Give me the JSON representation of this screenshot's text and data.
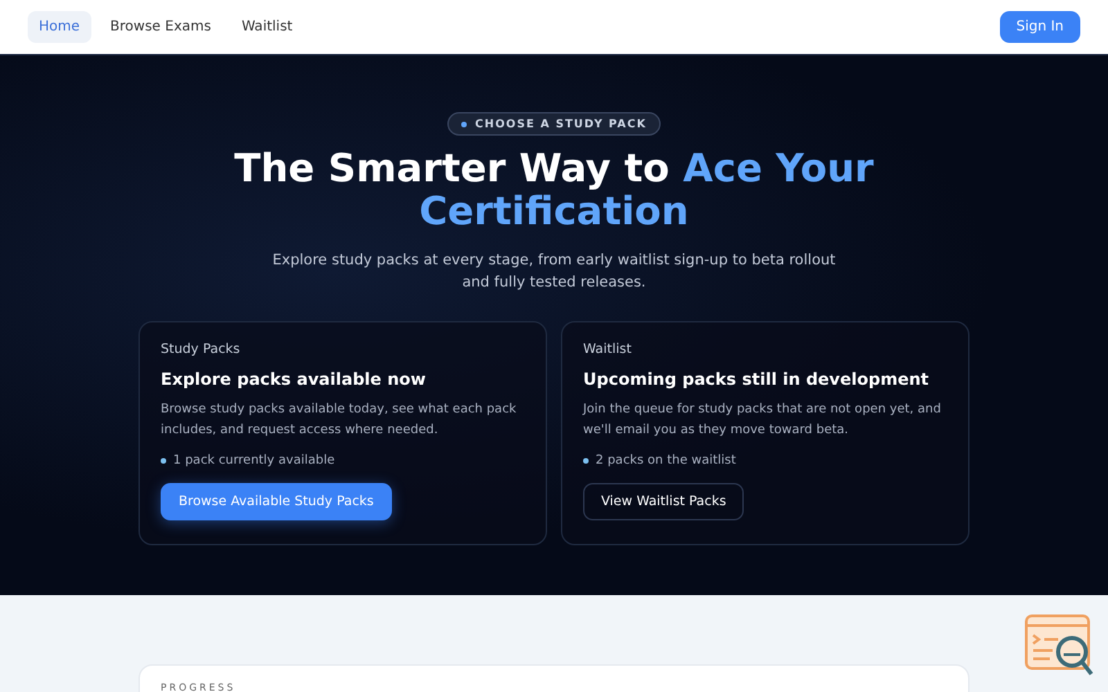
{
  "nav": {
    "items": [
      {
        "label": "Home",
        "selected": true
      },
      {
        "label": "Browse Exams",
        "selected": false
      },
      {
        "label": "Waitlist",
        "selected": false
      }
    ],
    "sign_in": "Sign In"
  },
  "hero": {
    "badge": "CHOOSE A STUDY PACK",
    "title": "The Smarter Way to",
    "title_accent": "Ace Your Certification",
    "subtitle": "Explore study packs at every stage, from early waitlist sign-up to beta rollout and fully tested releases."
  },
  "cards": [
    {
      "eyebrow": "Study Packs",
      "heading": "Explore packs available now",
      "text": "Browse study packs available today, see what each pack includes, and request access where needed.",
      "bullet": "1 pack currently available",
      "button": "Browse Available Study Packs",
      "kind": "primary"
    },
    {
      "eyebrow": "Waitlist",
      "heading": "Upcoming packs still in development",
      "text": "Join the queue for study packs that are not open yet, and we'll email you as they move toward beta.",
      "bullet": "2 packs on the waitlist",
      "button": "View Waitlist Packs",
      "kind": "outline"
    }
  ],
  "progress": {
    "label": "PROGRESS"
  }
}
